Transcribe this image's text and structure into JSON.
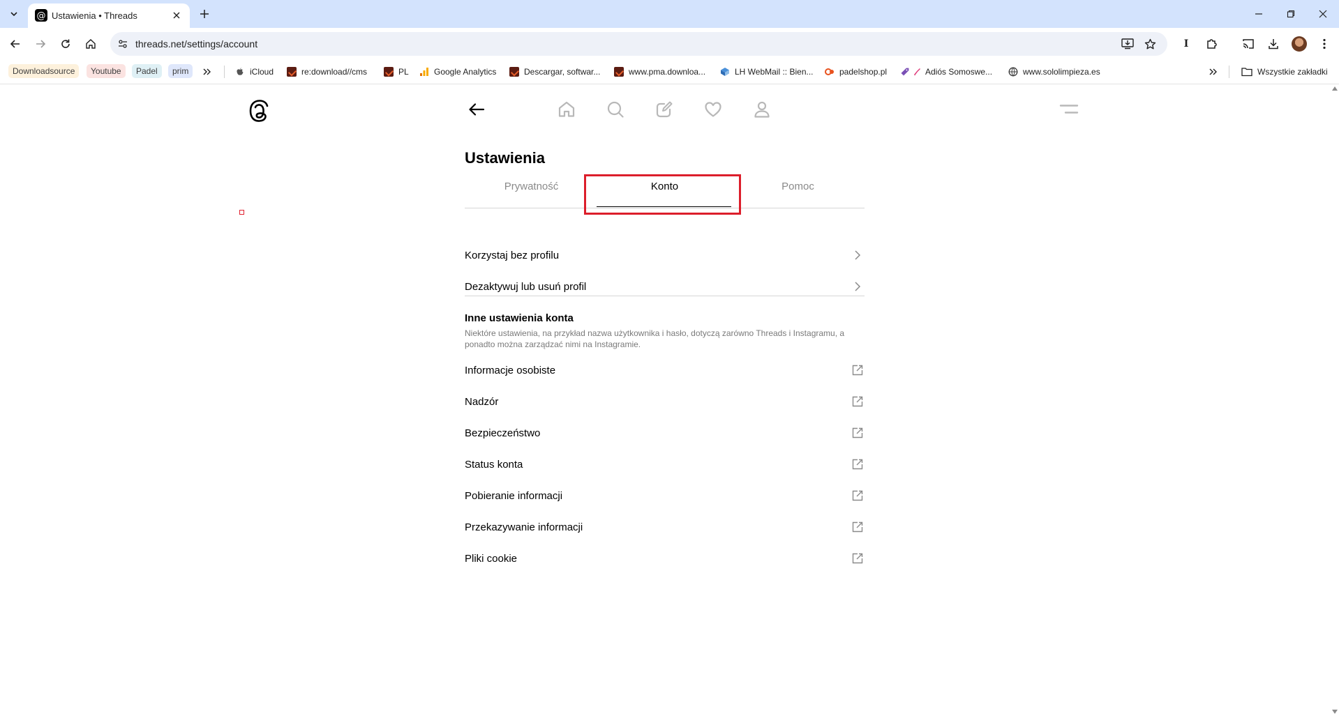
{
  "browser": {
    "tab_title": "Ustawienia • Threads",
    "url": "threads.net/settings/account",
    "bookmarks": [
      {
        "label": "Downloadsource",
        "style": "chip-1"
      },
      {
        "label": "Youtube",
        "style": "chip-2"
      },
      {
        "label": "Padel",
        "style": "chip-3"
      },
      {
        "label": "prim",
        "style": "chip-4"
      }
    ],
    "bookmarks_links": [
      {
        "label": "iCloud",
        "icon": "apple-icon"
      },
      {
        "label": "re:download//cms",
        "icon": "dl-favicon"
      },
      {
        "label": "PL",
        "icon": "dl-favicon"
      },
      {
        "label": "Google Analytics",
        "icon": "analytics-icon"
      },
      {
        "label": "Descargar, softwar...",
        "icon": "dl-favicon"
      },
      {
        "label": "www.pma.downloa...",
        "icon": "dl-favicon"
      },
      {
        "label": "LH WebMail :: Bien...",
        "icon": "webmail-icon"
      },
      {
        "label": "padelshop.pl",
        "icon": "padelshop-icon"
      },
      {
        "label": "Adiós Somoswe...",
        "icon": "rocket-icon"
      },
      {
        "label": "www.sololimpieza.es",
        "icon": "globe-icon"
      }
    ],
    "all_bookmarks": "Wszystkie zakładki"
  },
  "settings": {
    "title": "Ustawienia",
    "tabs": [
      {
        "label": "Prywatność"
      },
      {
        "label": "Konto"
      },
      {
        "label": "Pomoc"
      }
    ],
    "active_tab": "Konto",
    "top_items": [
      {
        "label": "Korzystaj bez profilu"
      },
      {
        "label": "Dezaktywuj lub usuń profil"
      }
    ],
    "other_section": {
      "title": "Inne ustawienia konta",
      "description": "Niektóre ustawienia, na przykład nazwa użytkownika i hasło, dotyczą zarówno Threads i Instagramu, a ponadto można zarządzać nimi na Instagramie."
    },
    "external_items": [
      {
        "label": "Informacje osobiste"
      },
      {
        "label": "Nadzór"
      },
      {
        "label": "Bezpieczeństwo"
      },
      {
        "label": "Status konta"
      },
      {
        "label": "Pobieranie informacji"
      },
      {
        "label": "Przekazywanie informacji"
      },
      {
        "label": "Pliki cookie"
      }
    ]
  },
  "colors": {
    "chrome_tabstrip": "#d3e3fd",
    "highlight_box": "#dc1e2b",
    "muted_text": "#8a8a8a"
  }
}
